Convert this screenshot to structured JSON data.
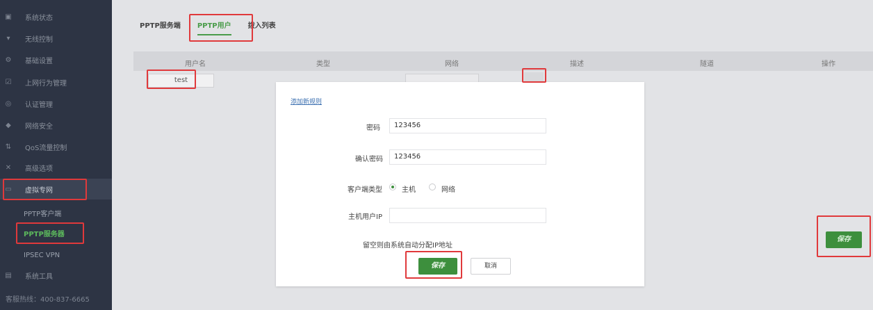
{
  "sidebar": {
    "items": [
      {
        "icon": "monitor-icon",
        "glyph": "▣",
        "label": "系统状态"
      },
      {
        "icon": "wifi-icon",
        "glyph": "▾",
        "label": "无线控制"
      },
      {
        "icon": "gear-icon",
        "glyph": "⚙",
        "label": "基础设置"
      },
      {
        "icon": "behavior-icon",
        "glyph": "☑",
        "label": "上网行为管理"
      },
      {
        "icon": "auth-icon",
        "glyph": "◎",
        "label": "认证管理"
      },
      {
        "icon": "shield-icon",
        "glyph": "◆",
        "label": "网络安全"
      },
      {
        "icon": "qos-icon",
        "glyph": "⇅",
        "label": "QoS流量控制"
      },
      {
        "icon": "tools-cross-icon",
        "glyph": "✕",
        "label": "高级选项"
      },
      {
        "icon": "vpn-icon",
        "glyph": "▭",
        "label": "虚拟专网"
      }
    ],
    "sub_items": [
      "PPTP客户端",
      "PPTP服务器",
      "IPSEC VPN"
    ],
    "system_tools": {
      "icon": "toolbox-icon",
      "glyph": "▤",
      "label": "系统工具"
    },
    "hotline": "客服热线：400-837-6665"
  },
  "tabs": [
    "PPTP服务端",
    "PPTP用户",
    "拨入列表"
  ],
  "table": {
    "headers": [
      "用户名",
      "类型",
      "网络",
      "描述",
      "隧道",
      "操作"
    ],
    "row": {
      "username": "test"
    }
  },
  "background_save": "保存",
  "dialog": {
    "title": "添加新规则",
    "password_label": "密码",
    "password_value": "123456",
    "confirm_label": "确认密码",
    "confirm_value": "123456",
    "client_type_label": "客户端类型",
    "client_type_options": [
      "主机",
      "网络"
    ],
    "client_type_selected": "主机",
    "host_ip_label": "主机用户IP",
    "host_ip_value": "",
    "hint": "留空则由系统自动分配IP地址",
    "save": "保存",
    "cancel": "取消"
  },
  "colors": {
    "accent": "#3d8f3d",
    "highlight": "#e0393b",
    "sidebar": "#2d3444"
  }
}
